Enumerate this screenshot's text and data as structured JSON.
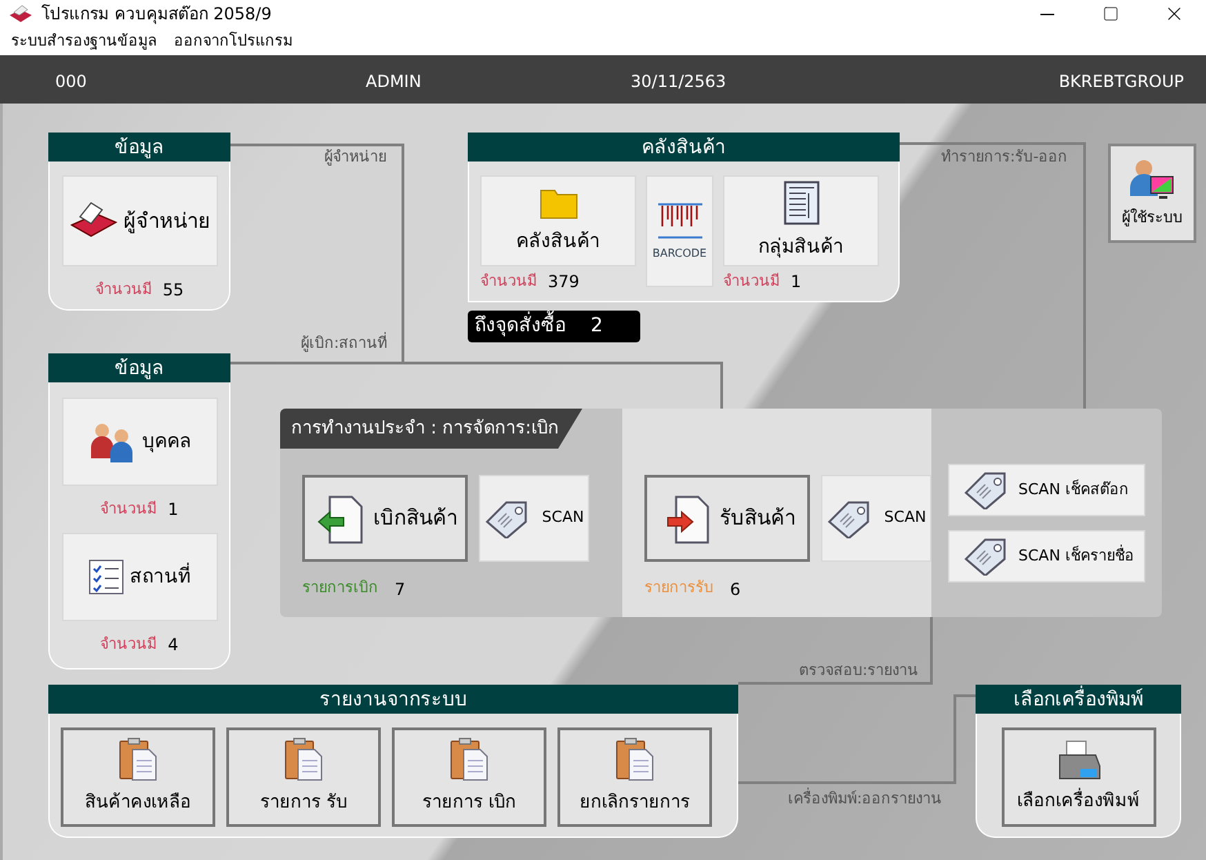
{
  "window": {
    "title": "โปรแกรม ควบคุมสต๊อก 2058/9"
  },
  "menu": [
    {
      "label": "ระบบสำรองฐานข้อมูล"
    },
    {
      "label": "ออกจากโปรแกรม"
    }
  ],
  "header": {
    "code": "000",
    "user": "ADMIN",
    "date": "30/11/2563",
    "company": "BKREBTGROUP"
  },
  "supplier_panel": {
    "title": "ข้อมูล",
    "button": "ผู้จำหน่าย",
    "count_label": "จำนวนมี",
    "count": "55"
  },
  "people_panel": {
    "title": "ข้อมูล",
    "items": [
      {
        "kind": "person",
        "label": "บุคคล",
        "count_label": "จำนวนมี",
        "count": "1"
      },
      {
        "kind": "place",
        "label": "สถานที่",
        "count_label": "จำนวนมี",
        "count": "4"
      }
    ]
  },
  "warehouse_panel": {
    "title": "คลังสินค้า",
    "items": [
      {
        "kind": "folder",
        "label": "คลังสินค้า",
        "count_label": "จำนวนมี",
        "count": "379"
      },
      {
        "kind": "barcode",
        "label": "BARCODE"
      },
      {
        "kind": "list",
        "label": "กลุ่มสินค้า",
        "count_label": "จำนวนมี",
        "count": "1"
      }
    ]
  },
  "reorder": {
    "label": "ถึงจุดสั่งซื้อ",
    "count": "2"
  },
  "user_button": {
    "label": "ผู้ใช้ระบบ"
  },
  "connectors": [
    {
      "label": "ผู้จำหน่าย"
    },
    {
      "label": "ผู้เบิก:สถานที่"
    },
    {
      "label": "ทำรายการ:รับ-ออก"
    },
    {
      "label": "ตรวจสอบ:รายงาน"
    },
    {
      "label": "เครื่องพิมพ์:ออกรายงาน"
    }
  ],
  "operations": {
    "title": "การทำงานประจำ : การจัดการ:เบิก",
    "sections": [
      {
        "kind": "issue",
        "button": "เบิกสินค้า",
        "scan": "SCAN",
        "count_label": "รายการเบิก",
        "count": "7",
        "color": "#3a8a2a"
      },
      {
        "kind": "receive",
        "button": "รับสินค้า",
        "scan": "SCAN",
        "count_label": "รายการรับ",
        "count": "6",
        "color": "#e89040"
      }
    ],
    "scan_buttons": [
      {
        "label": "SCAN เช็คสต๊อก"
      },
      {
        "label": "SCAN เช็ครายชื่อ"
      }
    ]
  },
  "reports": {
    "title": "รายงานจากระบบ",
    "buttons": [
      {
        "label": "สินค้าคงเหลือ"
      },
      {
        "label": "รายการ รับ"
      },
      {
        "label": "รายการ เบิก"
      },
      {
        "label": "ยกเลิกรายการ"
      }
    ]
  },
  "printer": {
    "title": "เลือกเครื่องพิมพ์",
    "button": "เลือกเครื่องพิมพ์"
  }
}
